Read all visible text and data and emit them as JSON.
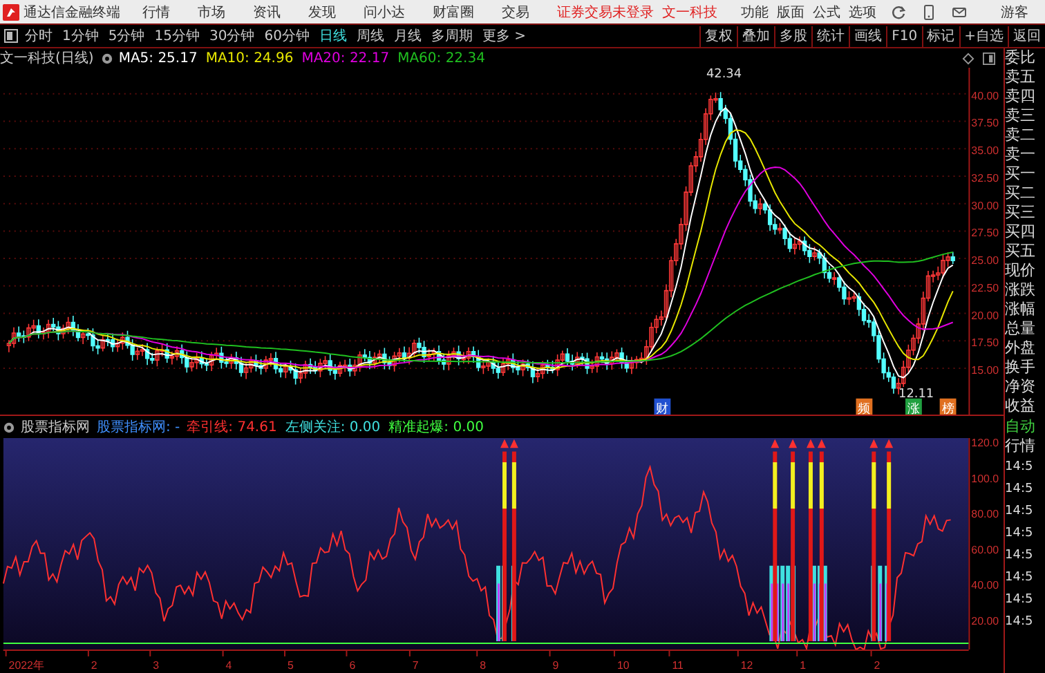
{
  "menu_bar": {
    "app_title": "通达信金融终端",
    "menus": [
      "行情",
      "市场",
      "资讯",
      "发现",
      "问小达",
      "财富圈",
      "交易"
    ],
    "login_status": "证券交易未登录",
    "stock_name": "文一科技",
    "functions": [
      "功能",
      "版面",
      "公式",
      "选项"
    ],
    "user": "游客"
  },
  "toolbar": {
    "periods": [
      {
        "label": "分时",
        "selected": false
      },
      {
        "label": "1分钟",
        "selected": false
      },
      {
        "label": "5分钟",
        "selected": false
      },
      {
        "label": "15分钟",
        "selected": false
      },
      {
        "label": "30分钟",
        "selected": false
      },
      {
        "label": "60分钟",
        "selected": false
      },
      {
        "label": "日线",
        "selected": true
      },
      {
        "label": "周线",
        "selected": false
      },
      {
        "label": "月线",
        "selected": false
      },
      {
        "label": "多周期",
        "selected": false
      }
    ],
    "more": "更多 >",
    "actions": [
      "复权",
      "叠加",
      "多股",
      "统计",
      "画线",
      "F10",
      "标记",
      "+自选",
      "返回"
    ]
  },
  "price_chart": {
    "title": "文一科技(日线)",
    "moving_averages": [
      {
        "label": "MA5: 25.17",
        "color": "#ffffff"
      },
      {
        "label": "MA10: 24.96",
        "color": "#e8e800"
      },
      {
        "label": "MA20: 22.17",
        "color": "#e000e0"
      },
      {
        "label": "MA60: 22.34",
        "color": "#20c020"
      }
    ],
    "y_ticks": [
      "40.00",
      "37.50",
      "35.00",
      "32.50",
      "30.00",
      "27.50",
      "25.00",
      "22.50",
      "20.00",
      "17.50",
      "15.00"
    ],
    "high_label": "42.34",
    "low_label": "12.11",
    "event_markers": [
      {
        "label": "财",
        "color": "#2050d0"
      },
      {
        "label": "频",
        "color": "#e07020"
      },
      {
        "label": "涨",
        "color": "#20a040"
      },
      {
        "label": "榜",
        "color": "#e07020"
      }
    ]
  },
  "indicator": {
    "name": "股票指标网",
    "formula": "股票指标网: -",
    "lines": [
      {
        "label": "牵引线: 74.61",
        "color": "#ff3030"
      },
      {
        "label": "左侧关注: 0.00",
        "color": "#40e0e0"
      },
      {
        "label": "精准起爆: 0.00",
        "color": "#40ff40"
      }
    ],
    "y_ticks": [
      "120.0",
      "100.0",
      "80.00",
      "60.00",
      "40.00",
      "20.00"
    ]
  },
  "date_axis": [
    "2022年",
    "2",
    "3",
    "4",
    "5",
    "6",
    "7",
    "8",
    "9",
    "10",
    "11",
    "12",
    "1",
    "2"
  ],
  "quote_panel": {
    "labels": [
      "委比",
      "卖五",
      "卖四",
      "卖三",
      "卖二",
      "卖一",
      "买一",
      "买二",
      "买三",
      "买四",
      "买五",
      "现价",
      "涨跌",
      "涨幅",
      "总量",
      "外盘",
      "换手",
      "净资",
      "收益"
    ],
    "auto": "自动",
    "tape_label": "行情",
    "times": [
      "14:5",
      "14:5",
      "14:5",
      "14:5",
      "14:5",
      "14:5",
      "14:5",
      "14:5"
    ]
  }
}
